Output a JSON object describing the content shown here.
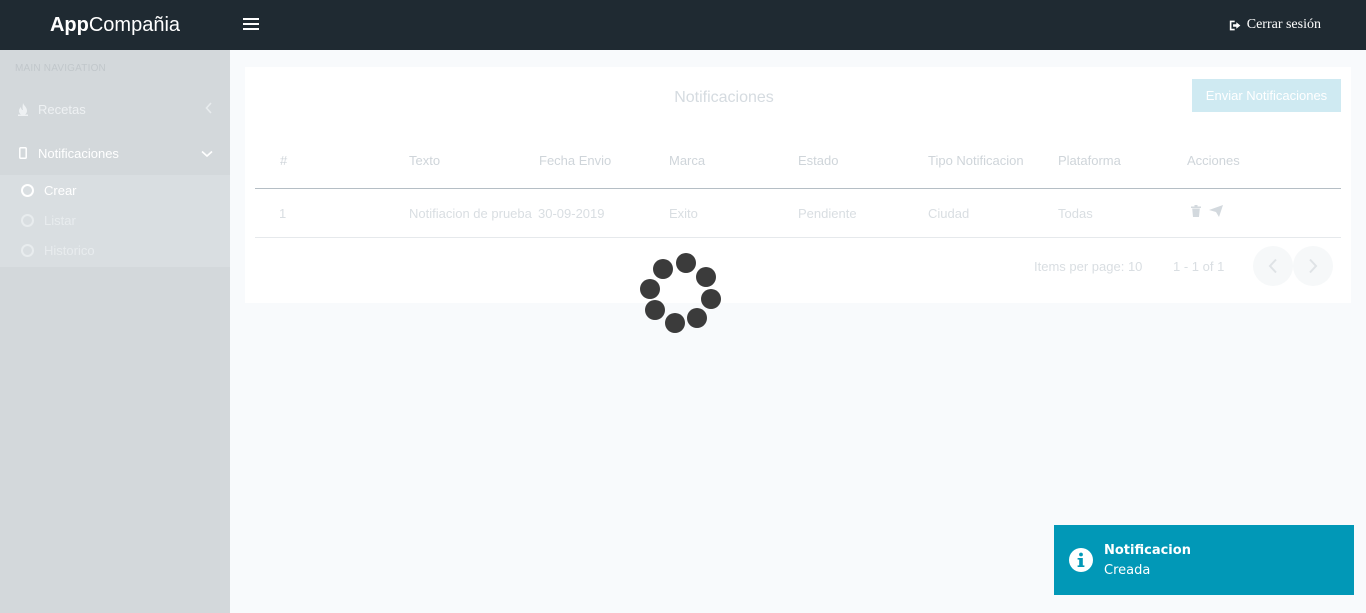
{
  "app": {
    "brand_bold": "App",
    "brand_rest": "Compañia",
    "logout_label": "Cerrar sesión"
  },
  "sidebar": {
    "header": "MAIN NAVIGATION",
    "items": [
      {
        "label": "Recetas",
        "icon": "fire-icon",
        "expanded": false
      },
      {
        "label": "Notificaciones",
        "icon": "mobile-icon",
        "expanded": true
      }
    ],
    "subitems": [
      {
        "label": "Crear",
        "active": true
      },
      {
        "label": "Listar",
        "active": false
      },
      {
        "label": "Historico",
        "active": false
      }
    ]
  },
  "main": {
    "title": "Notificaciones",
    "send_button": "Enviar Notificaciones",
    "table": {
      "columns": [
        "#",
        "Texto",
        "Fecha Envio",
        "Marca",
        "Estado",
        "Tipo Notificacion",
        "Plataforma",
        "Acciones"
      ],
      "rows": [
        [
          "1",
          "Notifiacion de prueba",
          "30-09-2019",
          "Exito",
          "Pendiente",
          "Ciudad",
          "Todas"
        ]
      ]
    },
    "paginator": {
      "items_per_page_label": "Items per page: 10",
      "range_label": "1 - 1 of 1"
    }
  },
  "toast": {
    "title": "Notificacion",
    "message": "Creada",
    "color": "#0198b7"
  },
  "colors": {
    "topbar": "#1f2a32",
    "sidebar": "#d3d8db",
    "spinner": "#3b3b3b"
  }
}
